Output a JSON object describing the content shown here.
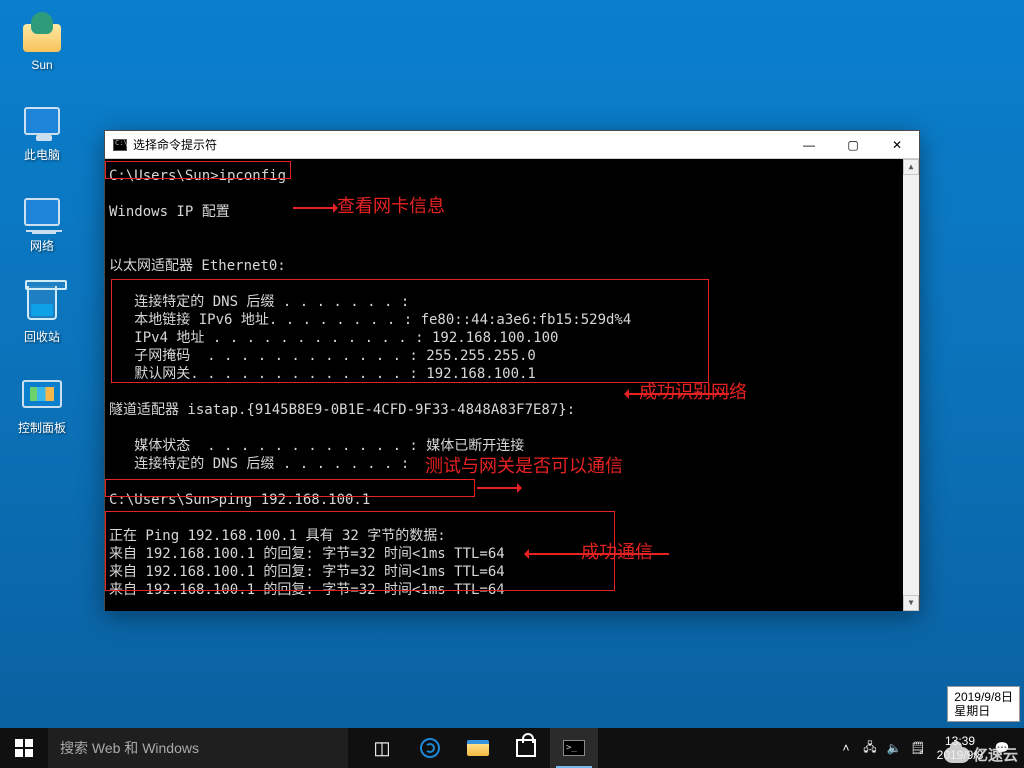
{
  "desktop_icons": {
    "sun": "Sun",
    "this_pc": "此电脑",
    "network": "网络",
    "recycle": "回收站",
    "control_panel": "控制面板"
  },
  "cmd": {
    "title": "选择命令提示符",
    "body": "C:\\Users\\Sun>ipconfig\n\nWindows IP 配置\n\n\n以太网适配器 Ethernet0:\n\n   连接特定的 DNS 后缀 . . . . . . . :\n   本地链接 IPv6 地址. . . . . . . . : fe80::44:a3e6:fb15:529d%4\n   IPv4 地址 . . . . . . . . . . . . : 192.168.100.100\n   子网掩码  . . . . . . . . . . . . : 255.255.255.0\n   默认网关. . . . . . . . . . . . . : 192.168.100.1\n\n隧道适配器 isatap.{9145B8E9-0B1E-4CFD-9F33-4848A83F7E87}:\n\n   媒体状态  . . . . . . . . . . . . : 媒体已断开连接\n   连接特定的 DNS 后缀 . . . . . . . :\n\nC:\\Users\\Sun>ping 192.168.100.1\n\n正在 Ping 192.168.100.1 具有 32 字节的数据:\n来自 192.168.100.1 的回复: 字节=32 时间<1ms TTL=64\n来自 192.168.100.1 的回复: 字节=32 时间<1ms TTL=64\n来自 192.168.100.1 的回复: 字节=32 时间<1ms TTL=64"
  },
  "annotations": {
    "a1": "查看网卡信息",
    "a2": "成功识别网络",
    "a3": "测试与网关是否可以通信",
    "a4": "成功通信"
  },
  "date_badge": {
    "date": "2019/9/8日",
    "weekday": "星期日"
  },
  "taskbar": {
    "search_placeholder": "搜索 Web 和 Windows",
    "time": "13:39",
    "date": "2019/9/8",
    "cmd_glyph": ">_"
  },
  "watermark": "亿速云"
}
